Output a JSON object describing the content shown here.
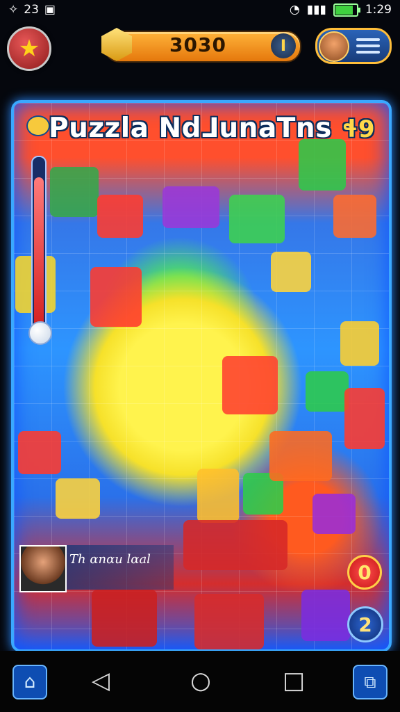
{
  "status_bar": {
    "left_number": "23",
    "time": "1:29",
    "battery_level": 0.9
  },
  "hud": {
    "score": "3030",
    "coin_plus": "I"
  },
  "board": {
    "title": "Puzzla Nd⅃unaTns",
    "title_suffix": "ɬ9",
    "progress": 0.9
  },
  "player": {
    "name": "Th ɑnɑu lɑal"
  },
  "badges": {
    "red": "0",
    "blue": "2"
  },
  "icons": {
    "star": "star-icon",
    "coin": "coin-icon",
    "menu": "menu-icon",
    "home": "home-icon",
    "back": "back-icon",
    "circle": "home-circle-icon",
    "recent": "recents-icon",
    "tasks": "tasks-icon"
  },
  "colors": {
    "board_border": "#3aa8ff",
    "coin_orange": "#f29a22",
    "accent_red": "#d91f1f"
  }
}
